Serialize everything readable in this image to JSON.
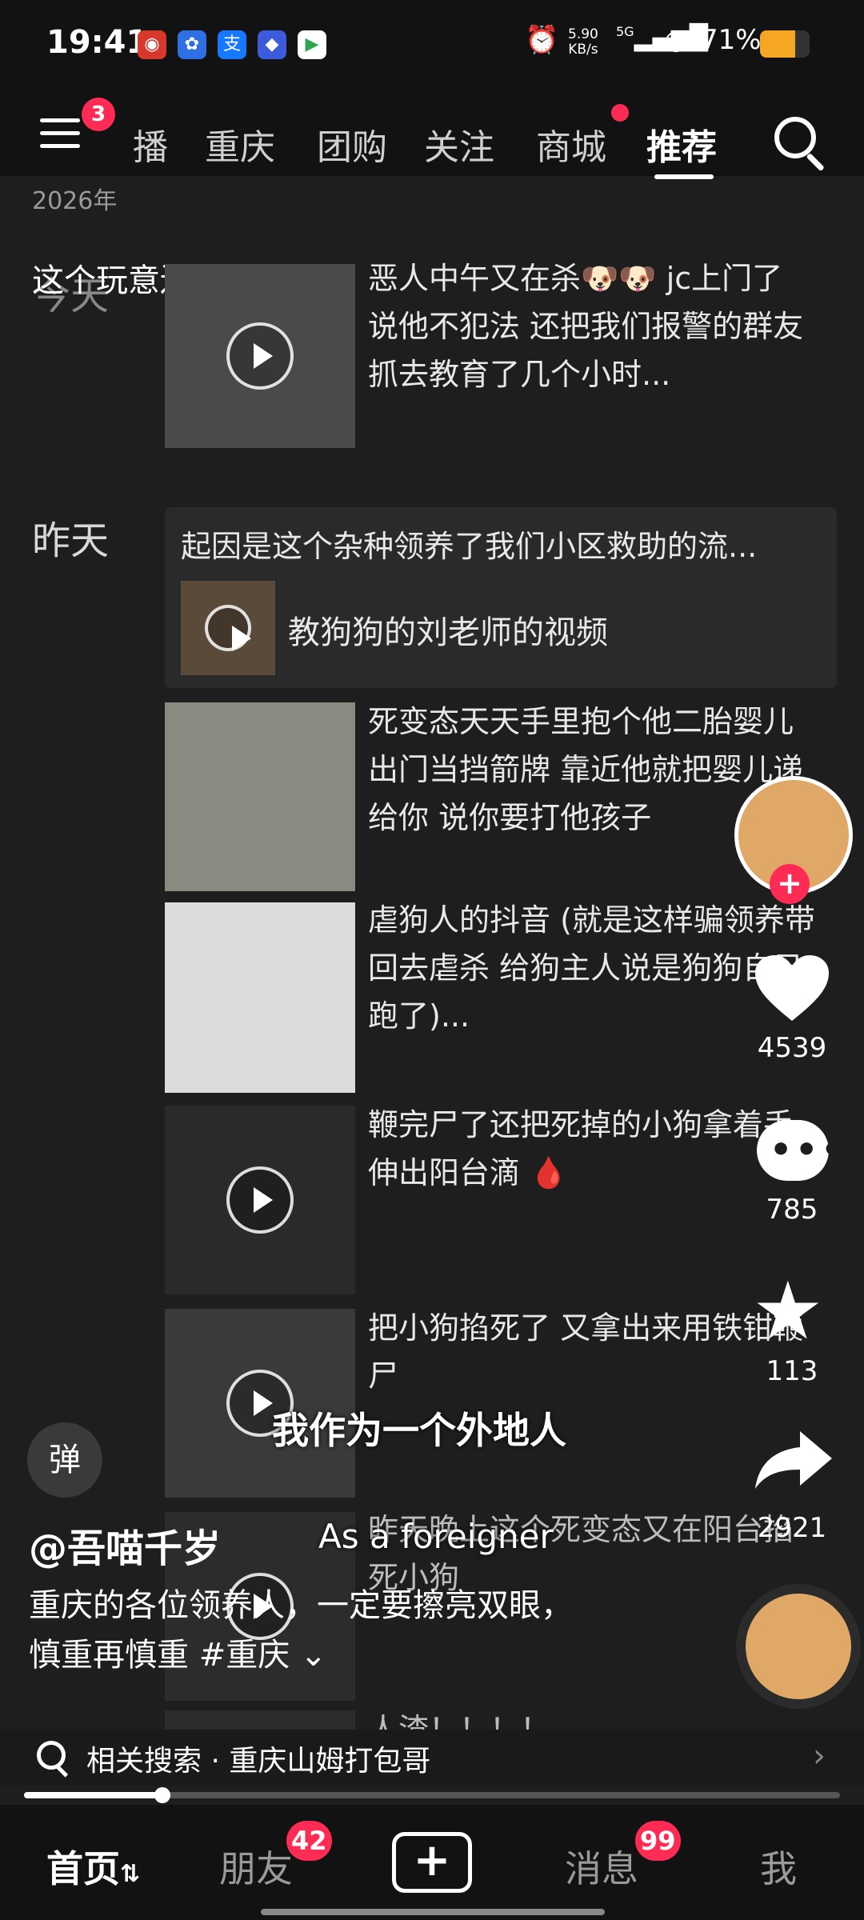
{
  "status_bar": {
    "time": "19:41",
    "net_speed_value": "5.90",
    "net_speed_unit": "KB/s",
    "signal": "5G",
    "battery_percent": "71%",
    "battery_level": 0.71
  },
  "top_nav": {
    "menu_badge": "3",
    "tabs": [
      "播",
      "重庆",
      "团购",
      "关注",
      "商城",
      "推荐"
    ],
    "active_tab": "推荐"
  },
  "feed": {
    "year_header": "2026年",
    "overlay_text": "这个玩意还穿尿布啊",
    "sections": [
      {
        "day": "今天"
      },
      {
        "day": "昨天"
      }
    ],
    "posts": [
      {
        "desc": "恶人中午又在杀🐶🐶 jc上门了 说他不犯法 还把我们报警的群友抓去教育了几个小时..."
      },
      {
        "desc": "死变态天天手里抱个他二胎婴儿出门当挡箭牌 靠近他就把婴儿递给你 说你要打他孩子"
      },
      {
        "desc": "虐狗人的抖音 (就是这样骗领养带回去虐杀 给狗主人说是狗狗自己跑了)..."
      },
      {
        "desc": "鞭完尸了还把死掉的小狗拿着手伸出阳台滴 🩸"
      },
      {
        "desc": "把小狗掐死了 又拿出来用铁钳鞭尸"
      },
      {
        "desc": "昨天晚上这个死变态又在阳台掐死小狗"
      },
      {
        "desc": "人渣！！！！"
      }
    ],
    "repost": {
      "text": "起因是这个杂种领养了我们小区救助的流...",
      "label": "教狗狗的刘老师的视频"
    }
  },
  "right_rail": {
    "likes": "4539",
    "comments": "785",
    "favorites": "113",
    "shares": "2921"
  },
  "video": {
    "danmu_label": "弹",
    "caption_cn": "我作为一个外地人",
    "caption_en": "As a foreigner",
    "author": "@吾喵千岁",
    "text_line1": "重庆的各位领养人，一定要擦亮双眼，",
    "text_line2": "慎重再慎重 #重庆 ⌄",
    "progress": 0.17
  },
  "related_search": {
    "text": "相关搜索 · 重庆山姆打包哥"
  },
  "bottom_nav": {
    "items": [
      "首页",
      "朋友",
      "消息",
      "我"
    ],
    "home_suffix": "⇅",
    "friends_badge": "42",
    "messages_badge": "99"
  },
  "colors": {
    "accent": "#fe2c55",
    "background": "#1e1e1e",
    "battery": "#f5a623"
  }
}
